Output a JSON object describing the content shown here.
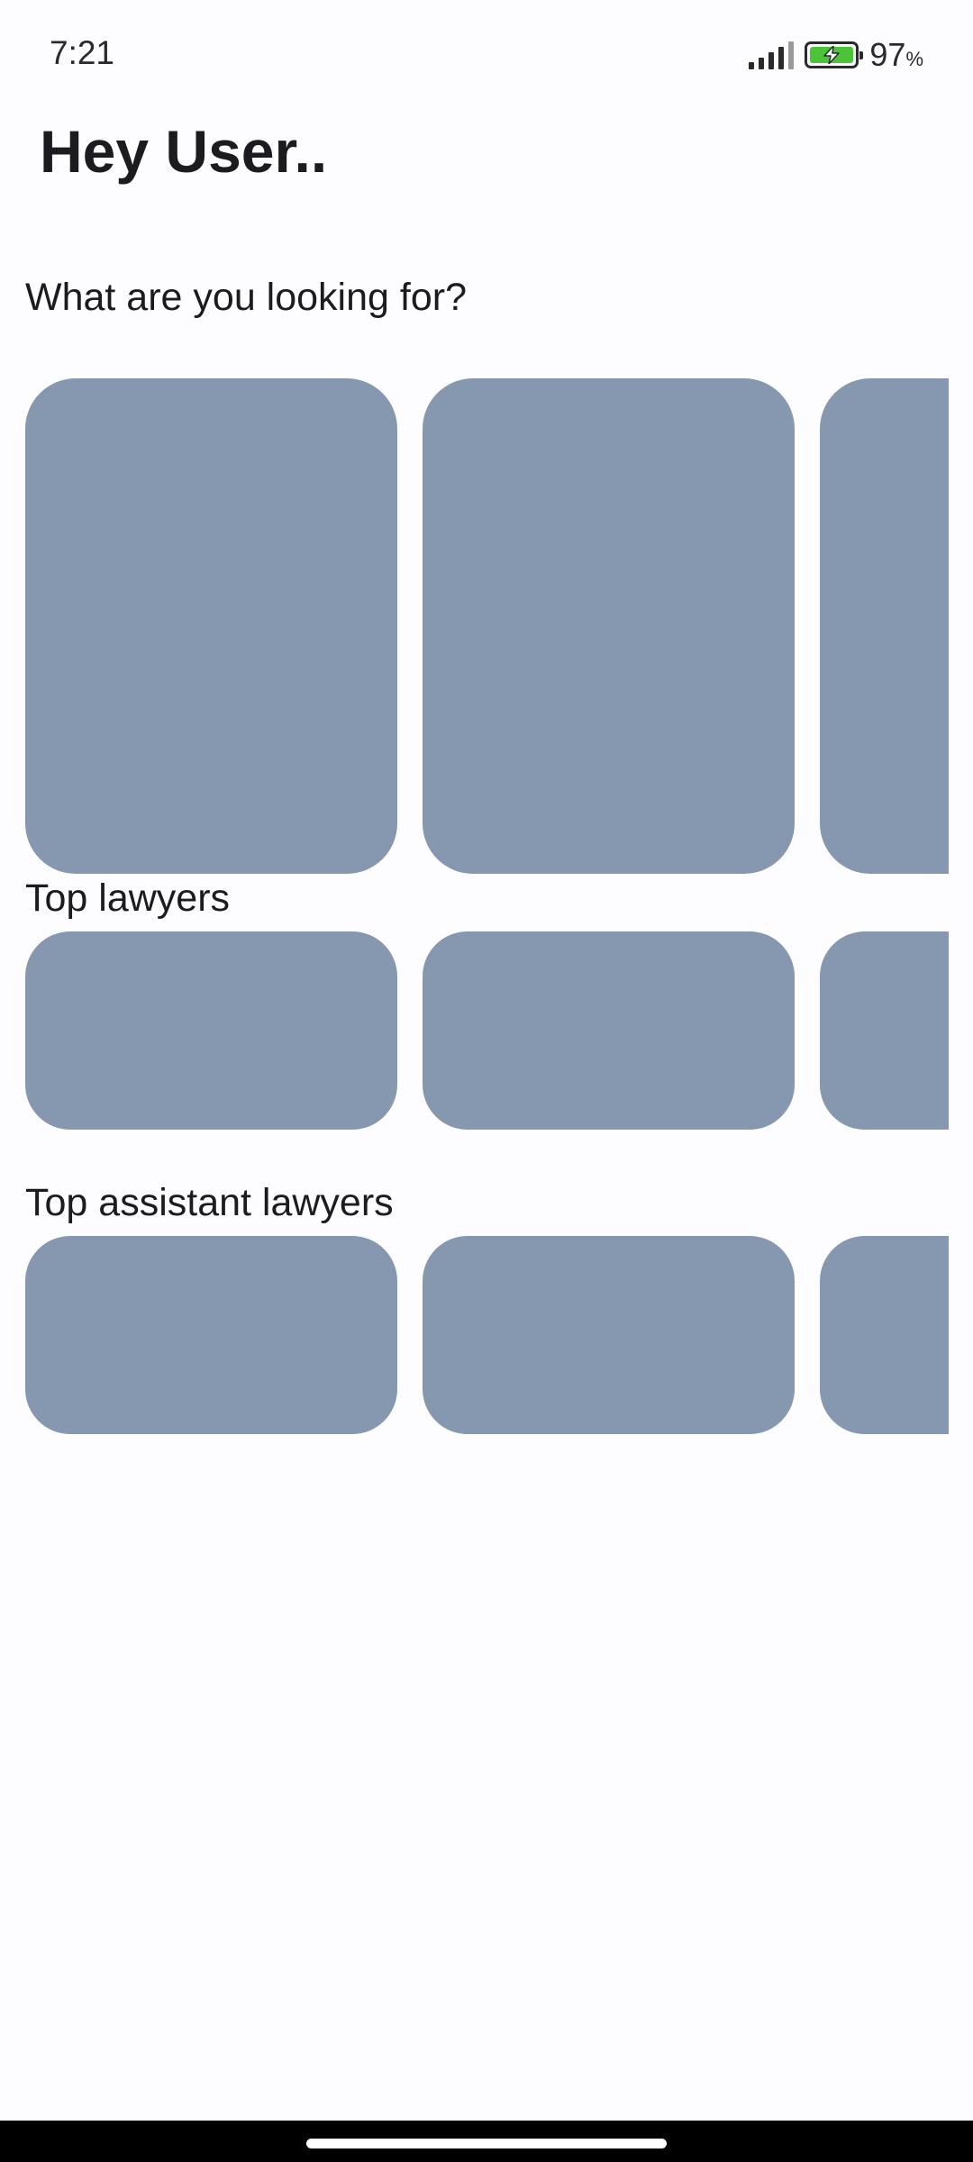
{
  "status_bar": {
    "time": "7:21",
    "battery_percent": "97",
    "battery_unit": "%",
    "signal_icon": "cellular-signal-icon",
    "battery_icon": "battery-charging-icon",
    "battery_level": 0.97
  },
  "header": {
    "greeting": "Hey User.."
  },
  "sections": {
    "categories_prompt": "What are you looking for?",
    "top_lawyers_label": "Top lawyers",
    "top_assistants_label": "Top assistant lawyers"
  },
  "colors": {
    "background": "#fdfcff",
    "card": "#8697b0",
    "battery_fill": "#4cc43a",
    "nav_bar": "#000000"
  }
}
